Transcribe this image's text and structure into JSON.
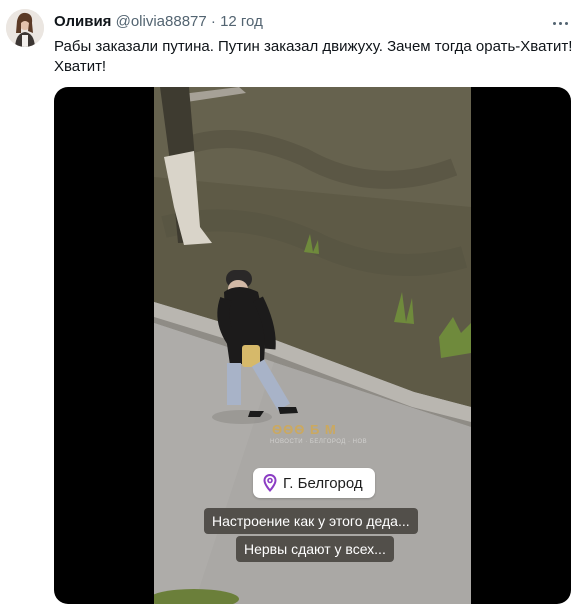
{
  "author": {
    "name": "Оливия",
    "handle": "@olivia88877",
    "separator": "·",
    "time": "12 год"
  },
  "tweet_text": "Рабы заказали путина. Путин заказал движуху. Зачем тогда орать-Хватит! Хватит!",
  "video": {
    "location_label": "Г. Белгород",
    "caption_line1": "Настроение как у этого деда...",
    "caption_line2": "Нервы сдают у всех...",
    "watermark": "ѲѲѲ Б М",
    "watermark_sub": "НОВОСТИ · БЕЛГОРОД · НОВ"
  },
  "colors": {
    "text": "#0f1419",
    "secondary": "#536471",
    "location_pin": "#8b3cc4",
    "caption_bg": "#46423e"
  },
  "icons": [
    "more-options-icon",
    "location-pin-icon"
  ]
}
